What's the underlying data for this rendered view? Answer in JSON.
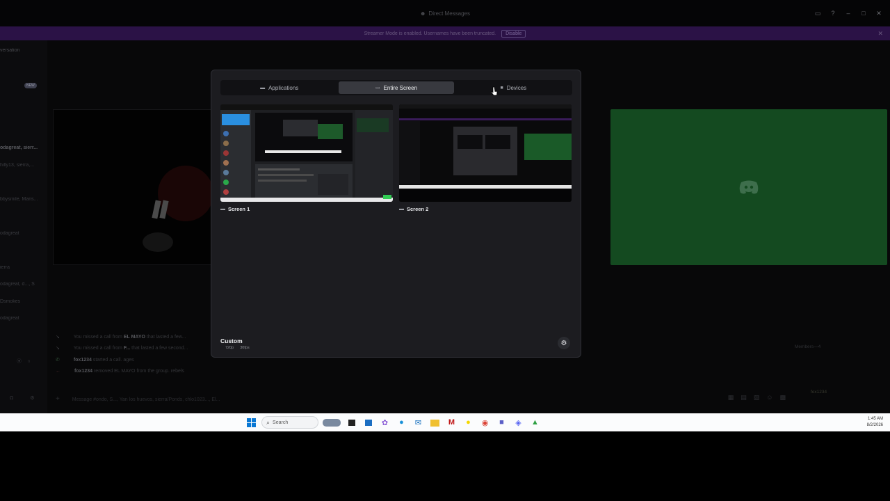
{
  "window": {
    "title": "Direct Messages",
    "controls": {
      "minimize": "–",
      "maximize": "□",
      "close": "✕"
    }
  },
  "streamer_banner": {
    "text": "Streamer Mode is enabled. Usernames have been truncated.",
    "button": "Disable",
    "close": "✕"
  },
  "sidebar": {
    "header": "versation",
    "new_badge": "NEW",
    "items": [
      "odagreat, sierr...",
      "hilly13, sierra,...",
      "bbysmile, Maris...",
      "odagreat",
      "ierra",
      "odagreat, d..., S",
      "Dsmokes",
      "odagreat"
    ]
  },
  "feed": {
    "rows": [
      {
        "pre": "You missed a call from ",
        "name": "EL MAYO",
        "post": " that lasted a few..."
      },
      {
        "pre": "You missed a call from ",
        "name": "F...",
        "post": " that lasted a few second..."
      },
      {
        "pre": "",
        "name": "fox1234",
        "post": " started a call. ages"
      },
      {
        "pre": "",
        "name": "fox1234",
        "post": " removed EL MAYO from the group. rebels"
      }
    ],
    "composer_placeholder": "Message #ondo, S..., Yan los huevos, sierra/Ponds, chlo1023..., El..."
  },
  "members": {
    "header": "Members—4",
    "member": "fox1234"
  },
  "modal": {
    "tabs": [
      {
        "label": "Applications",
        "icon": "window-icon",
        "active": false
      },
      {
        "label": "Entire Screen",
        "icon": "monitor-icon",
        "active": true
      },
      {
        "label": "Devices",
        "icon": "camera-icon",
        "active": false
      }
    ],
    "sources": [
      {
        "label": "Screen 1",
        "icon": "monitor-icon"
      },
      {
        "label": "Screen 2",
        "icon": "monitor-icon"
      }
    ],
    "quality": {
      "title": "Custom",
      "resolution": "720p",
      "framerate": "30fps"
    },
    "settings_icon": "gear-icon"
  },
  "taskbar": {
    "search_placeholder": "Search",
    "time": "1:45 AM",
    "date": "8/2/2026",
    "apps": [
      "windows-start-icon",
      "search-icon",
      "widget-icon",
      "task-view-icon",
      "store-icon",
      "copilot-icon",
      "edge-icon",
      "outlook-icon",
      "file-explorer-icon",
      "mcafee-icon",
      "snapchat-icon",
      "chrome-icon",
      "teams-icon",
      "discord-icon",
      "android-icon"
    ]
  },
  "colors": {
    "accent_purple": "#2b1246",
    "modal_bg": "#1c1c20",
    "active_tab": "#38393f",
    "green_tile": "#144a20"
  }
}
